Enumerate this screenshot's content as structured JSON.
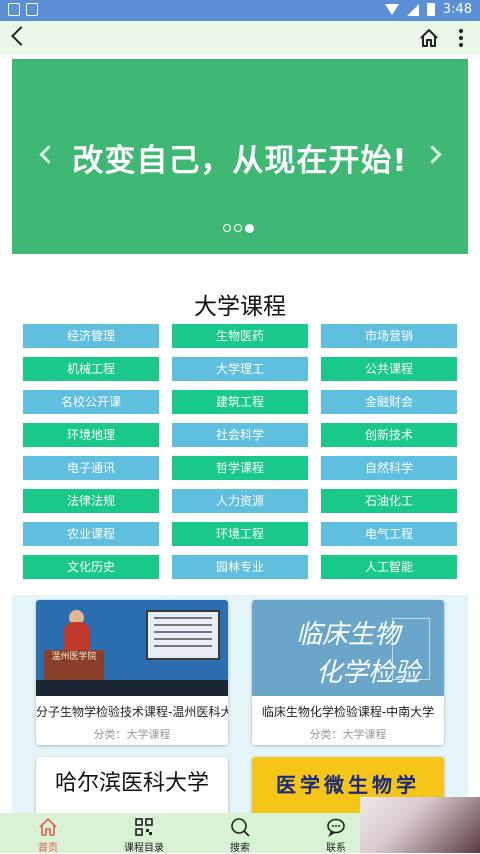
{
  "status_bar": {
    "time": "3:48"
  },
  "banner": {
    "text": "改变自己，从现在开始!",
    "page_count": 3,
    "active_page": 3
  },
  "section": {
    "title": "大学课程",
    "categories": [
      {
        "label": "经济管理",
        "color": "blue"
      },
      {
        "label": "生物医药",
        "color": "green"
      },
      {
        "label": "市场营销",
        "color": "blue"
      },
      {
        "label": "机械工程",
        "color": "green"
      },
      {
        "label": "大学理工",
        "color": "blue"
      },
      {
        "label": "公共课程",
        "color": "green"
      },
      {
        "label": "名校公开课",
        "color": "blue"
      },
      {
        "label": "建筑工程",
        "color": "green"
      },
      {
        "label": "金融财会",
        "color": "blue"
      },
      {
        "label": "环境地理",
        "color": "green"
      },
      {
        "label": "社会科学",
        "color": "blue"
      },
      {
        "label": "创新技术",
        "color": "green"
      },
      {
        "label": "电子通讯",
        "color": "blue"
      },
      {
        "label": "哲学课程",
        "color": "green"
      },
      {
        "label": "自然科学",
        "color": "blue"
      },
      {
        "label": "法律法规",
        "color": "green"
      },
      {
        "label": "人力资源",
        "color": "blue"
      },
      {
        "label": "石油化工",
        "color": "green"
      },
      {
        "label": "农业课程",
        "color": "blue"
      },
      {
        "label": "环境工程",
        "color": "green"
      },
      {
        "label": "电气工程",
        "color": "blue"
      },
      {
        "label": "文化历史",
        "color": "green"
      },
      {
        "label": "园林专业",
        "color": "blue"
      },
      {
        "label": "人工智能",
        "color": "green"
      }
    ]
  },
  "cards": [
    {
      "title": "分子生物学检验技术课程-温州医科大",
      "category": "分类：大学课程",
      "thumb_text": "温州医学院"
    },
    {
      "title": "临床生物化学检验课程-中南大学",
      "category": "分类：大学课程",
      "thumb_line1": "临床生物",
      "thumb_line2": "化学检验"
    },
    {
      "thumb_text": "哈尔滨医科大学"
    },
    {
      "thumb_text": "医学微生物学"
    }
  ],
  "bottom_nav": [
    {
      "label": "首页",
      "active": true
    },
    {
      "label": "课程目录",
      "active": false
    },
    {
      "label": "搜索",
      "active": false
    },
    {
      "label": "联系",
      "active": false
    }
  ],
  "colors": {
    "status_bar": "#5b8fd6",
    "banner": "#3fb874",
    "chip_blue": "#5fbfdf",
    "chip_green": "#18c98a",
    "nav_active": "#e0604a"
  }
}
